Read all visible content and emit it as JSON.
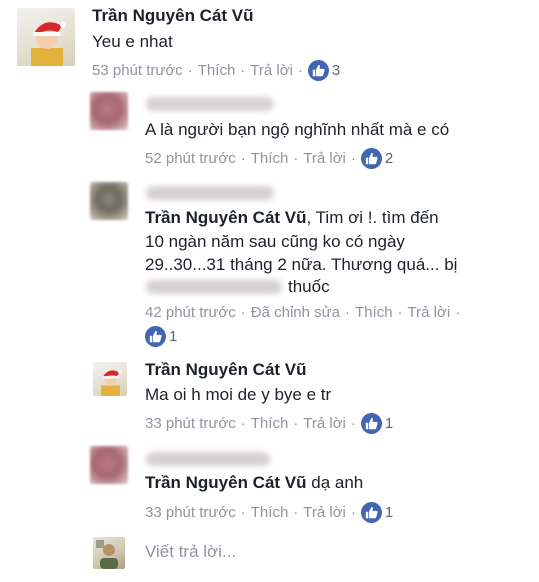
{
  "comments": [
    {
      "author": "Trần Nguyên Cát Vũ",
      "text": "Yeu e nhat",
      "time": "53 phút trước",
      "like": "Thích",
      "reply": "Trả lời",
      "reactions": "3"
    },
    {
      "author": "",
      "text": "A là người bạn ngộ nghĩnh nhất mà e có",
      "time": "52 phút trước",
      "like": "Thích",
      "reply": "Trả lời",
      "reactions": "2"
    },
    {
      "author": "Trần Nguyên Cát Vũ",
      "mention": "Tim ơi !. tìm đến",
      "lines": [
        "10 ngàn năm sau cũng ko có ngày",
        "29..30...31 tháng 2 nữa. Thương quá... bị",
        "thuốc"
      ],
      "time": "42 phút trước",
      "edited": "Đã chỉnh sửa",
      "like": "Thích",
      "reply": "Trả lời",
      "reactions": "1"
    },
    {
      "author": "Trần Nguyên Cát Vũ",
      "text": "Ma oi h moi de y bye e tr",
      "time": "33 phút trước",
      "like": "Thích",
      "reply": "Trả lời",
      "reactions": "1"
    },
    {
      "author": "Trần Nguyên Cát Vũ",
      "text": "dạ anh",
      "time": "33 phút trước",
      "like": "Thích",
      "reply": "Trả lời",
      "reactions": "1"
    }
  ],
  "separator": "·",
  "reply_placeholder": "Viết trả lời...",
  "colors": {
    "link_blue": "#4267b2",
    "meta_gray": "#90949c",
    "text": "#1d2129"
  },
  "icons": [
    "thumbs-up-icon"
  ]
}
